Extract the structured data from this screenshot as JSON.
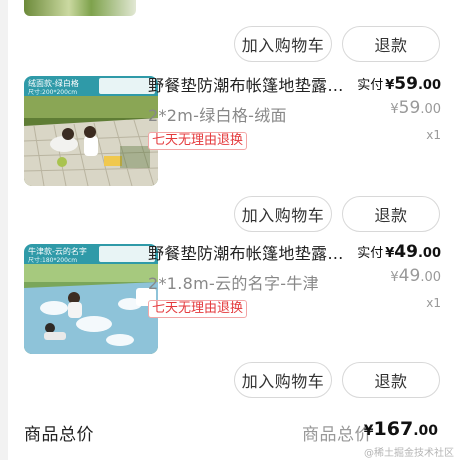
{
  "top_actions": {
    "add_cart": "加入购物车",
    "refund": "退款"
  },
  "items": [
    {
      "thumb_tag": "绒面款-绿白格",
      "thumb_size": "尺寸:200*200cm",
      "title": "野餐垫防潮布帐篷地垫露营…",
      "variant": "2*2m-绿白格-绒面",
      "badge": "七天无理由退换",
      "paid_label": "实付",
      "currency": "¥",
      "paid_int": "59",
      "paid_dec": ".00",
      "orig_int": "59",
      "orig_dec": ".00",
      "qty": "x1",
      "add_cart": "加入购物车",
      "refund": "退款"
    },
    {
      "thumb_tag": "牛津款-云的名字",
      "thumb_size": "尺寸:180*200cm",
      "title": "野餐垫防潮布帐篷地垫露营…",
      "variant": "2*1.8m-云的名字-牛津",
      "badge": "七天无理由退换",
      "paid_label": "实付",
      "currency": "¥",
      "paid_int": "49",
      "paid_dec": ".00",
      "orig_int": "49",
      "orig_dec": ".00",
      "qty": "x1",
      "add_cart": "加入购物车",
      "refund": "退款"
    }
  ],
  "total": {
    "label_left": "商品总价",
    "label_right": "商品总价",
    "currency": "¥",
    "int": "167",
    "dec": ".00"
  },
  "watermark": "@稀土掘金技术社区"
}
